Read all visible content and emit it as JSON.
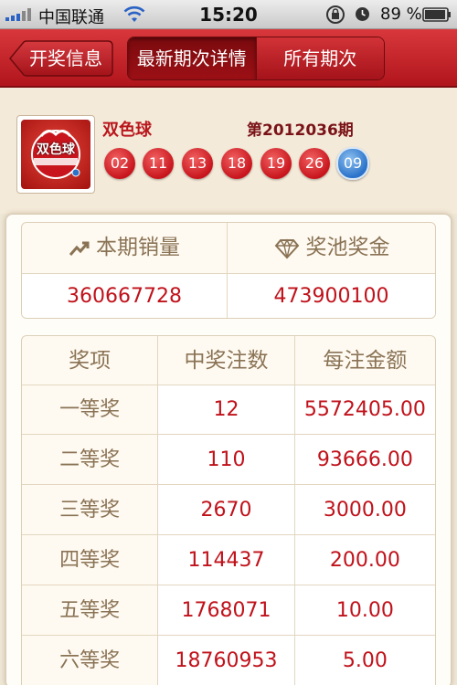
{
  "status_bar": {
    "carrier": "中国联通",
    "time": "15:20",
    "battery": "89 %"
  },
  "nav": {
    "back_label": "开奖信息",
    "segments": [
      "最新期次详情",
      "所有期次"
    ],
    "active_segment": 0
  },
  "lottery": {
    "name": "双色球",
    "issue": "第2012036期",
    "logo_text": "双色球",
    "red_balls": [
      "02",
      "11",
      "13",
      "18",
      "19",
      "26"
    ],
    "blue_balls": [
      "09"
    ]
  },
  "summary": {
    "sales_label": "本期销量",
    "pool_label": "奖池奖金",
    "sales_value": "360667728",
    "pool_value": "473900100"
  },
  "prizes": {
    "headers": [
      "奖项",
      "中奖注数",
      "每注金额"
    ],
    "rows": [
      {
        "level": "一等奖",
        "count": "12",
        "amount": "5572405.00"
      },
      {
        "level": "二等奖",
        "count": "110",
        "amount": "93666.00"
      },
      {
        "level": "三等奖",
        "count": "2670",
        "amount": "3000.00"
      },
      {
        "level": "四等奖",
        "count": "114437",
        "amount": "200.00"
      },
      {
        "level": "五等奖",
        "count": "1768071",
        "amount": "10.00"
      },
      {
        "level": "六等奖",
        "count": "18760953",
        "amount": "5.00"
      }
    ]
  },
  "colors": {
    "brand_red": "#c0121b",
    "ball_red": "#c8151d",
    "ball_blue": "#2a73c9",
    "label_brown": "#8a7355"
  }
}
